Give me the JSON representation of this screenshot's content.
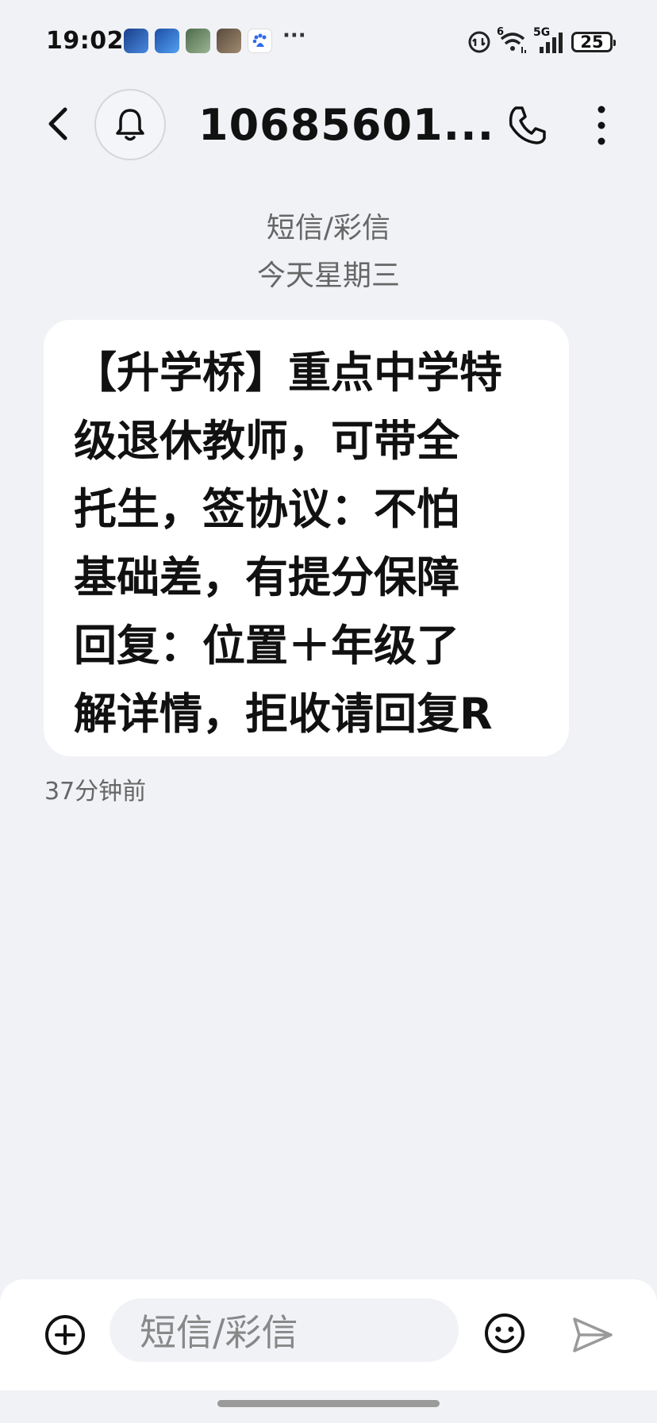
{
  "status_bar": {
    "time": "19:02",
    "notification_icons": [
      "app-icon-blue",
      "app-icon-tech",
      "app-icon-photo",
      "app-icon-game",
      "baidu-icon"
    ],
    "notification_colors": [
      "#2A5BB8",
      "#2C6FD6",
      "#6D8A6A",
      "#7D6B5A",
      "#2F6BEA"
    ],
    "more_indicator": "···",
    "network_label": "5G",
    "wifi_badge": "6",
    "battery_level": "25"
  },
  "header": {
    "contact_name": "10685601...",
    "back_icon": "chevron-left-icon",
    "bell_icon": "bell-icon",
    "call_icon": "phone-icon",
    "menu_icon": "more-vertical-icon"
  },
  "conversation": {
    "type_label": "短信/彩信",
    "date_label": "今天星期三",
    "messages": [
      {
        "text": "【升学桥】重点中学特\n级退休教师，可带全\n托生，签协议：不怕\n基础差，有提分保障\n回复：位置＋年级了\n解详情，拒收请回复R",
        "time": "37分钟前"
      }
    ]
  },
  "compose": {
    "placeholder": "短信/彩信",
    "add_icon": "plus-circle-icon",
    "emoji_icon": "smiley-icon",
    "send_icon": "send-icon"
  },
  "colors": {
    "background": "#F1F2F6",
    "bubble": "#FFFFFF",
    "text_primary": "#111111",
    "text_secondary": "#666666"
  }
}
